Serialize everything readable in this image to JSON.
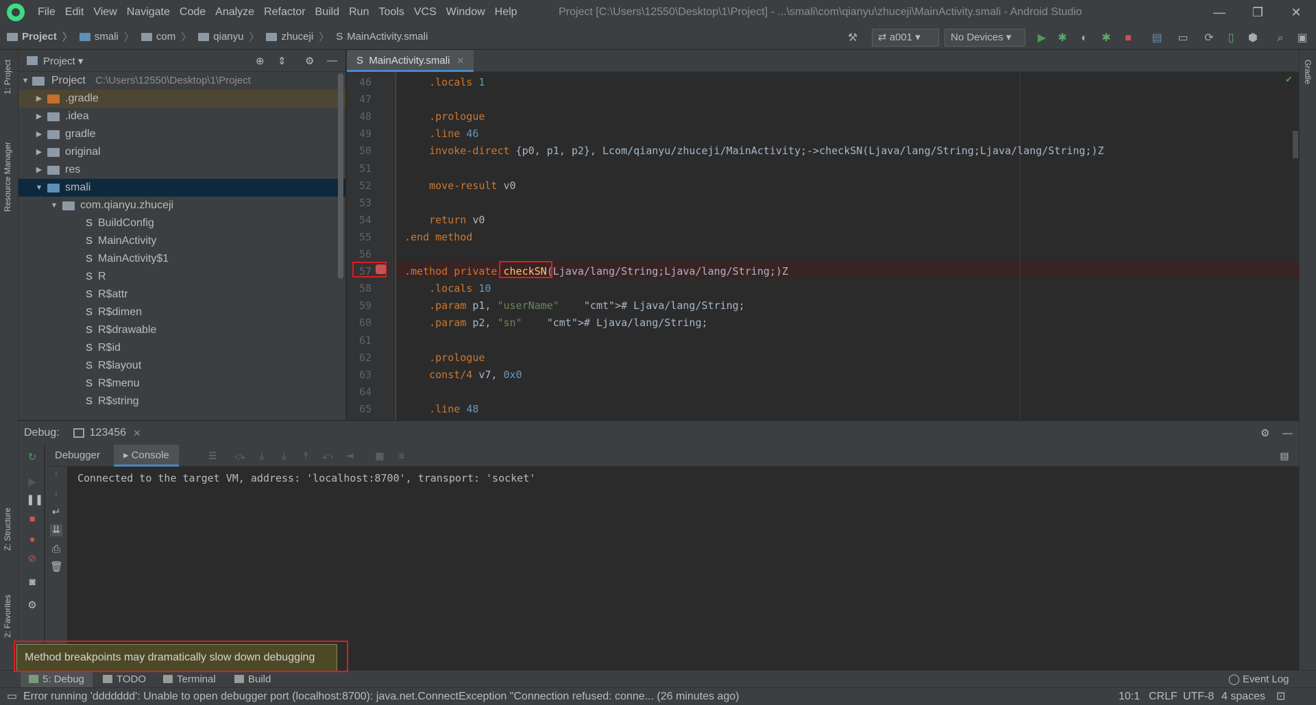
{
  "window": {
    "title": "Project [C:\\Users\\12550\\Desktop\\1\\Project] - ...\\smali\\com\\qianyu\\zhuceji\\MainActivity.smali - Android Studio"
  },
  "menu": [
    "File",
    "Edit",
    "View",
    "Navigate",
    "Code",
    "Analyze",
    "Refactor",
    "Build",
    "Run",
    "Tools",
    "VCS",
    "Window",
    "Help"
  ],
  "breadcrumb": [
    "Project",
    "smali",
    "com",
    "qianyu",
    "zhuceji",
    "MainActivity.smali"
  ],
  "toolbar": {
    "run_config": "a001",
    "device": "No Devices"
  },
  "left_stripe": {
    "project_tab": "1: Project",
    "resource_tab": "Resource Manager",
    "structure_tab": "Z: Structure",
    "favorites_tab": "2: Favorites"
  },
  "right_stripe": {
    "gradle_tab": "Gradle"
  },
  "project_panel": {
    "title": "Project",
    "root": {
      "label": "Project",
      "path": "C:\\Users\\12550\\Desktop\\1\\Project"
    },
    "items": [
      {
        "label": ".gradle",
        "type": "folder",
        "color": "#c46f2e"
      },
      {
        "label": ".idea",
        "type": "folder",
        "color": "#8d9aa6"
      },
      {
        "label": "gradle",
        "type": "folder",
        "color": "#8d9aa6"
      },
      {
        "label": "original",
        "type": "folder",
        "color": "#8d9aa6"
      },
      {
        "label": "res",
        "type": "folder",
        "color": "#8d9aa6"
      },
      {
        "label": "smali",
        "type": "folder",
        "color": "#5e8fb7"
      },
      {
        "label": "com.qianyu.zhuceji",
        "type": "package",
        "color": "#8d9aa6"
      },
      {
        "label": "BuildConfig",
        "type": "smali"
      },
      {
        "label": "MainActivity",
        "type": "smali"
      },
      {
        "label": "MainActivity$1",
        "type": "smali"
      },
      {
        "label": "R",
        "type": "smali"
      },
      {
        "label": "R$attr",
        "type": "smali"
      },
      {
        "label": "R$dimen",
        "type": "smali"
      },
      {
        "label": "R$drawable",
        "type": "smali"
      },
      {
        "label": "R$id",
        "type": "smali"
      },
      {
        "label": "R$layout",
        "type": "smali"
      },
      {
        "label": "R$menu",
        "type": "smali"
      },
      {
        "label": "R$string",
        "type": "smali"
      }
    ]
  },
  "editor": {
    "tab": "MainActivity.smali",
    "lines": [
      {
        "n": "46",
        "code": "    .locals 1"
      },
      {
        "n": "47",
        "code": ""
      },
      {
        "n": "48",
        "code": "    .prologue"
      },
      {
        "n": "49",
        "code": "    .line 46"
      },
      {
        "n": "50",
        "code": "    invoke-direct {p0, p1, p2}, Lcom/qianyu/zhuceji/MainActivity;->checkSN(Ljava/lang/String;Ljava/lang/String;)Z"
      },
      {
        "n": "51",
        "code": ""
      },
      {
        "n": "52",
        "code": "    move-result v0"
      },
      {
        "n": "53",
        "code": ""
      },
      {
        "n": "54",
        "code": "    return v0"
      },
      {
        "n": "55",
        "code": ".end method"
      },
      {
        "n": "56",
        "code": ""
      },
      {
        "n": "57",
        "code": ".method private checkSN(Ljava/lang/String;Ljava/lang/String;)Z"
      },
      {
        "n": "58",
        "code": "    .locals 10"
      },
      {
        "n": "59",
        "code": "    .param p1, \"userName\"    # Ljava/lang/String;"
      },
      {
        "n": "60",
        "code": "    .param p2, \"sn\"    # Ljava/lang/String;"
      },
      {
        "n": "61",
        "code": ""
      },
      {
        "n": "62",
        "code": "    .prologue"
      },
      {
        "n": "63",
        "code": "    const/4 v7, 0x0"
      },
      {
        "n": "64",
        "code": ""
      },
      {
        "n": "65",
        "code": "    .line 48"
      }
    ]
  },
  "debug": {
    "title": "Debug:",
    "session": "123456",
    "tabs": [
      "Debugger",
      "Console"
    ],
    "console_output": "Connected to the target VM, address: 'localhost:8700', transport: 'socket'"
  },
  "balloon": {
    "message": "Method breakpoints may dramatically slow down debugging"
  },
  "bottom_tabs": [
    "5: Debug",
    "TODO",
    "Terminal",
    "Build"
  ],
  "event_log": "Event Log",
  "status": {
    "message": "Error running 'ddddddd': Unable to open debugger port (localhost:8700): java.net.ConnectException \"Connection refused: conne... (26 minutes ago)",
    "position": "10:1",
    "line_sep": "CRLF",
    "encoding": "UTF-8",
    "indent": "4 spaces"
  }
}
